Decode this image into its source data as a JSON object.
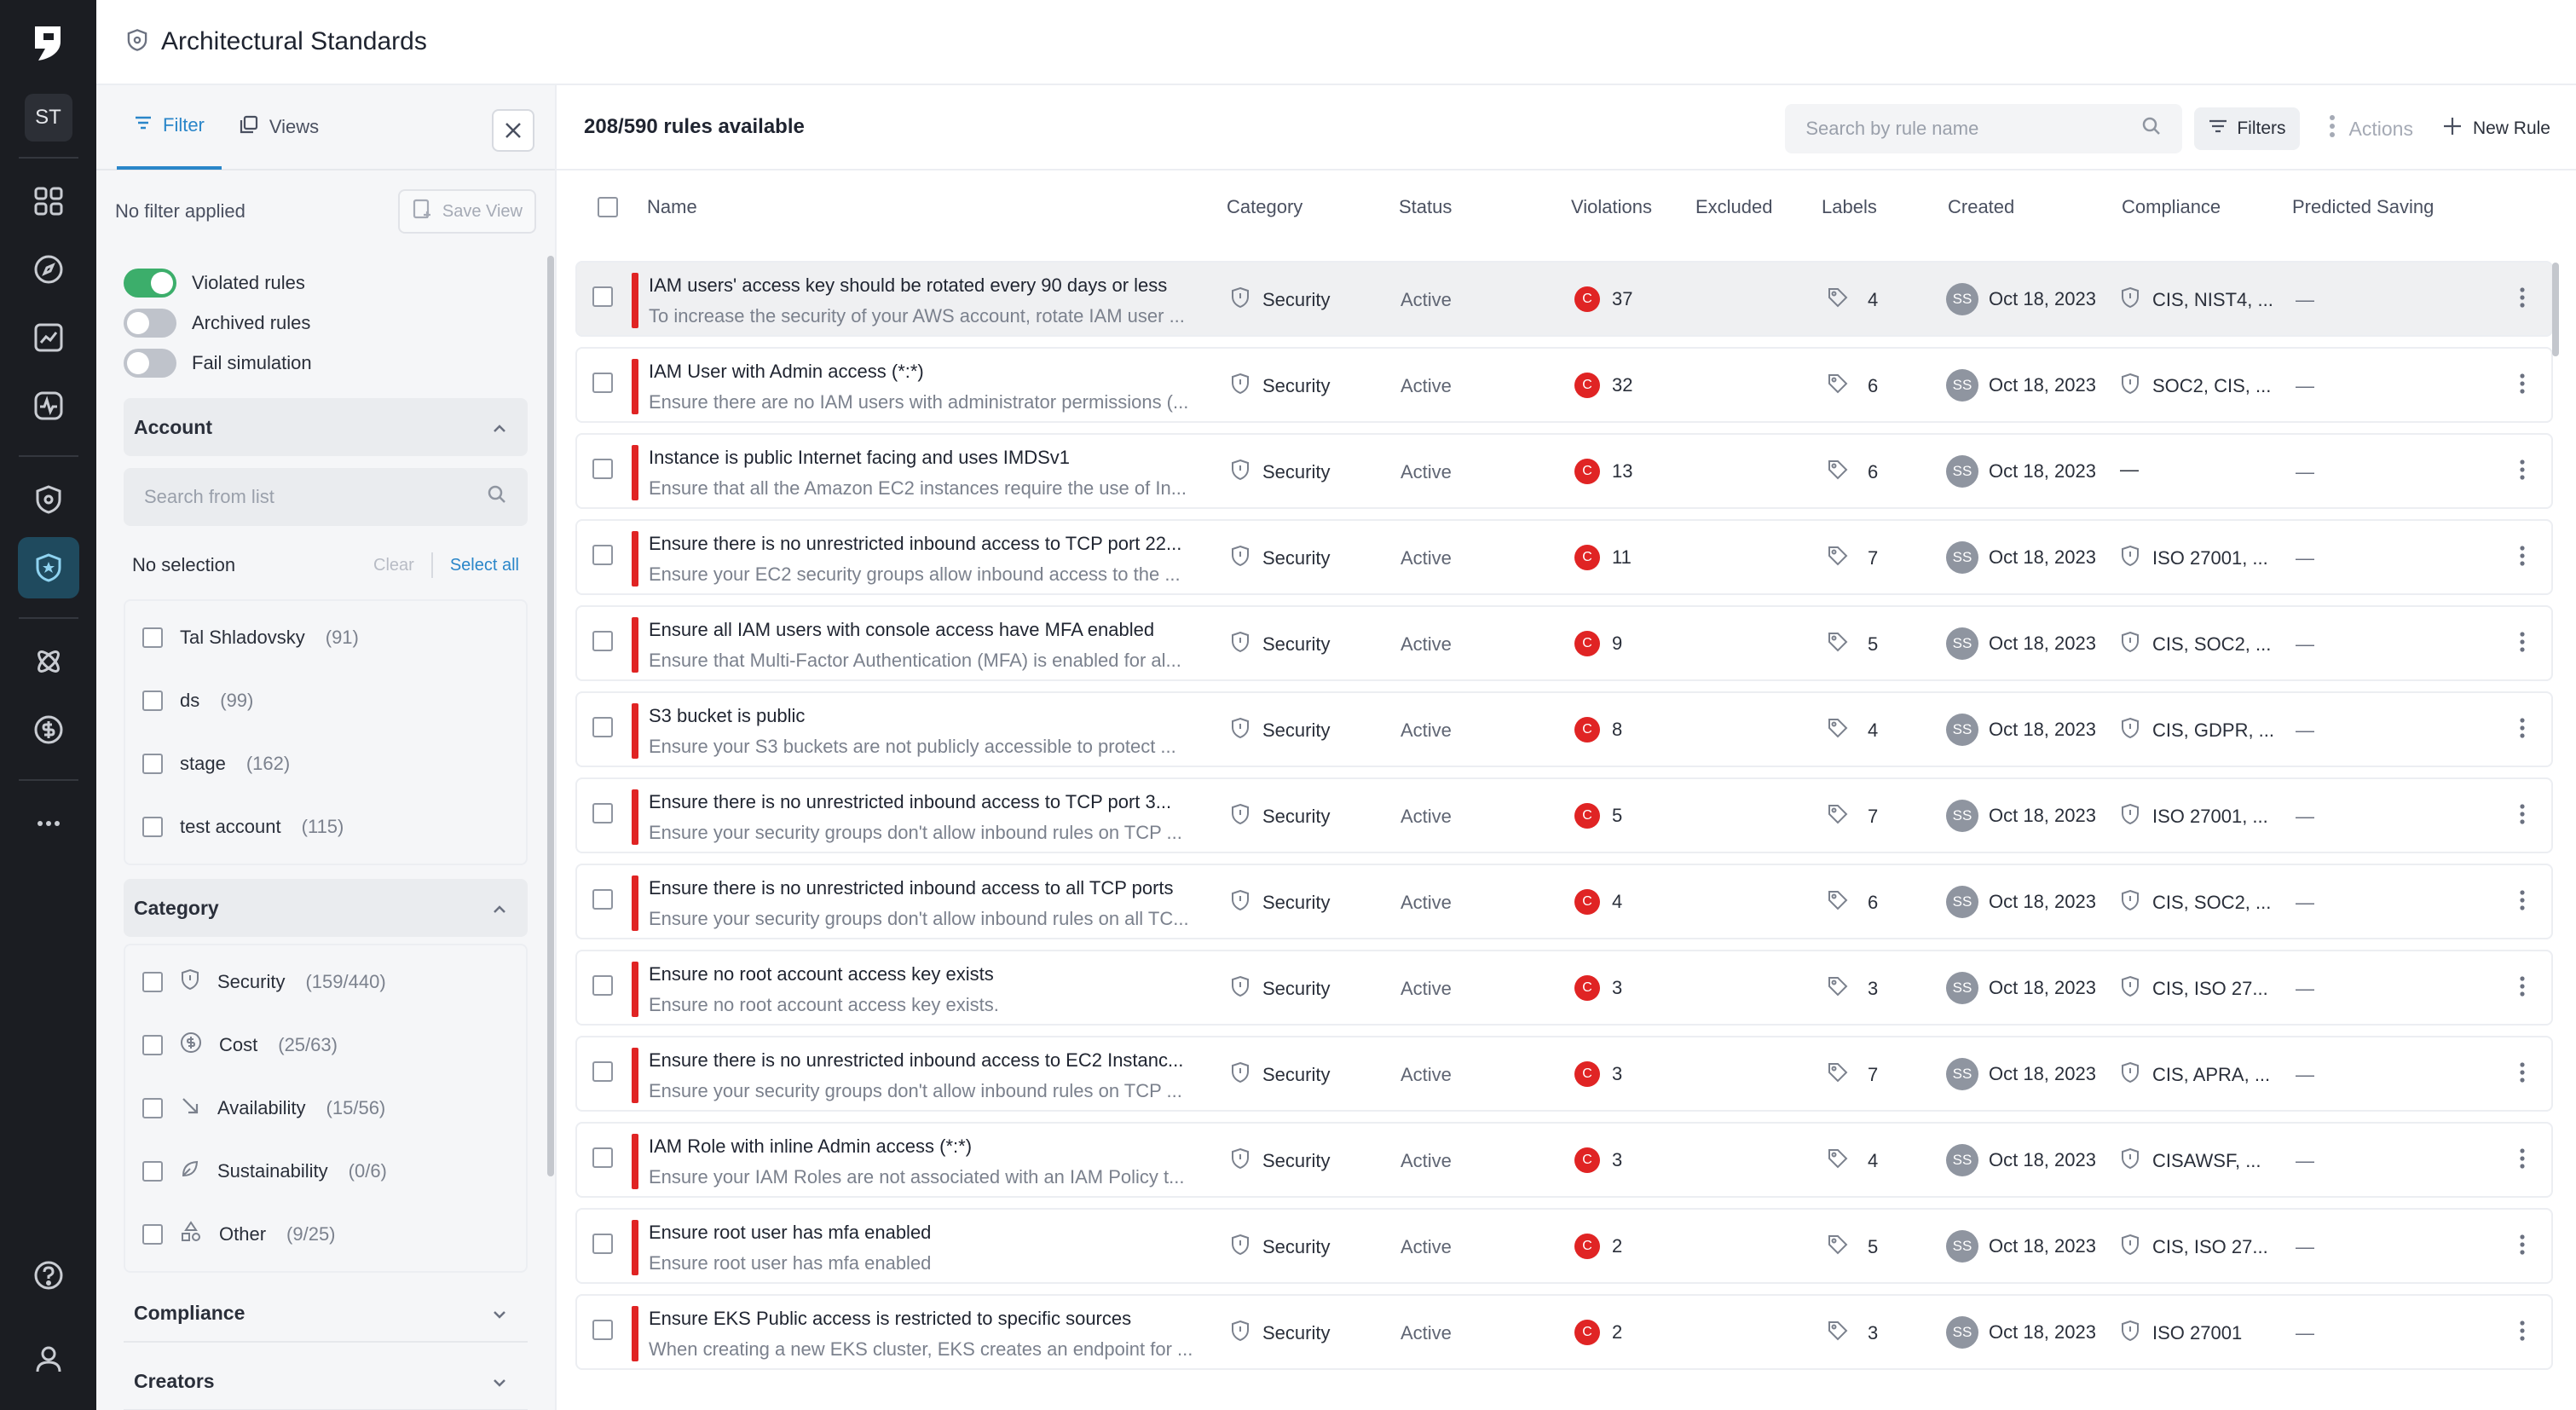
{
  "nav": {
    "avatar_initials": "ST",
    "items": [
      "grid-icon",
      "compass-icon",
      "chart-icon",
      "activity-icon",
      "shield-gear-icon",
      "shield-star-icon",
      "atom-icon",
      "dollar-icon",
      "more-icon"
    ],
    "bottom": [
      "help-icon",
      "user-icon"
    ]
  },
  "header": {
    "title": "Architectural Standards"
  },
  "filter_pane": {
    "tabs": [
      {
        "label": "Filter"
      },
      {
        "label": "Views"
      }
    ],
    "no_filter": "No filter applied",
    "save_view": "Save View",
    "toggles": [
      {
        "label": "Violated rules",
        "on": true
      },
      {
        "label": "Archived rules",
        "on": false
      },
      {
        "label": "Fail simulation",
        "on": false
      }
    ],
    "account": {
      "title": "Account",
      "search_placeholder": "Search from list",
      "no_selection": "No selection",
      "clear": "Clear",
      "select_all": "Select all",
      "options": [
        {
          "label": "Tal Shladovsky",
          "count": "(91)"
        },
        {
          "label": "ds",
          "count": "(99)"
        },
        {
          "label": "stage",
          "count": "(162)"
        },
        {
          "label": "test account",
          "count": "(115)"
        }
      ]
    },
    "category": {
      "title": "Category",
      "options": [
        {
          "label": "Security",
          "count": "(159/440)",
          "icon": "shield-icon"
        },
        {
          "label": "Cost",
          "count": "(25/63)",
          "icon": "dollar-icon"
        },
        {
          "label": "Availability",
          "count": "(15/56)",
          "icon": "arrow-down-right-icon"
        },
        {
          "label": "Sustainability",
          "count": "(0/6)",
          "icon": "leaf-icon"
        },
        {
          "label": "Other",
          "count": "(9/25)",
          "icon": "shapes-icon"
        }
      ]
    },
    "compliance": {
      "title": "Compliance"
    },
    "creators": {
      "title": "Creators"
    }
  },
  "toolbar": {
    "count": "208/590 rules available",
    "search_placeholder": "Search by rule name",
    "filters": "Filters",
    "actions": "Actions",
    "new_rule": "New Rule"
  },
  "columns": {
    "name": "Name",
    "category": "Category",
    "status": "Status",
    "violations": "Violations",
    "excluded": "Excluded",
    "labels": "Labels",
    "created": "Created",
    "compliance": "Compliance",
    "predicted_saving": "Predicted Saving"
  },
  "rows": [
    {
      "title": "IAM users' access key should be rotated every 90 days or less",
      "desc": "To increase the security of your AWS account, rotate IAM user ...",
      "category": "Security",
      "status": "Active",
      "badge": "C",
      "violations": "37",
      "labels": "4",
      "creator": "SS",
      "created": "Oct 18, 2023",
      "compliance": "CIS, NIST4, ...",
      "saving": "—"
    },
    {
      "title": "IAM User with Admin access (*:*)",
      "desc": "Ensure there are no IAM users with administrator permissions (...",
      "category": "Security",
      "status": "Active",
      "badge": "C",
      "violations": "32",
      "labels": "6",
      "creator": "SS",
      "created": "Oct 18, 2023",
      "compliance": "SOC2, CIS, ...",
      "saving": "—"
    },
    {
      "title": "Instance is public Internet facing and uses IMDSv1",
      "desc": "Ensure that all the Amazon EC2 instances require the use of In...",
      "category": "Security",
      "status": "Active",
      "badge": "C",
      "violations": "13",
      "labels": "6",
      "creator": "SS",
      "created": "Oct 18, 2023",
      "compliance": "—",
      "saving": "—"
    },
    {
      "title": "Ensure there is no unrestricted inbound access to TCP port 22...",
      "desc": "Ensure your EC2 security groups allow inbound access to the ...",
      "category": "Security",
      "status": "Active",
      "badge": "C",
      "violations": "11",
      "labels": "7",
      "creator": "SS",
      "created": "Oct 18, 2023",
      "compliance": "ISO 27001, ...",
      "saving": "—"
    },
    {
      "title": "Ensure all IAM users with console access have MFA enabled",
      "desc": "Ensure that Multi-Factor Authentication (MFA) is enabled for al...",
      "category": "Security",
      "status": "Active",
      "badge": "C",
      "violations": "9",
      "labels": "5",
      "creator": "SS",
      "created": "Oct 18, 2023",
      "compliance": "CIS, SOC2, ...",
      "saving": "—"
    },
    {
      "title": "S3 bucket is public",
      "desc": "Ensure your S3 buckets are not publicly accessible to protect ...",
      "category": "Security",
      "status": "Active",
      "badge": "C",
      "violations": "8",
      "labels": "4",
      "creator": "SS",
      "created": "Oct 18, 2023",
      "compliance": "CIS, GDPR, ...",
      "saving": "—"
    },
    {
      "title": "Ensure there is no unrestricted inbound access to TCP port 3...",
      "desc": "Ensure your security groups don't allow inbound rules on TCP ...",
      "category": "Security",
      "status": "Active",
      "badge": "C",
      "violations": "5",
      "labels": "7",
      "creator": "SS",
      "created": "Oct 18, 2023",
      "compliance": "ISO 27001, ...",
      "saving": "—"
    },
    {
      "title": "Ensure there is no unrestricted inbound access to all TCP ports",
      "desc": "Ensure your security groups don't allow inbound rules on all TC...",
      "category": "Security",
      "status": "Active",
      "badge": "C",
      "violations": "4",
      "labels": "6",
      "creator": "SS",
      "created": "Oct 18, 2023",
      "compliance": "CIS, SOC2, ...",
      "saving": "—"
    },
    {
      "title": "Ensure no root account access key exists",
      "desc": "Ensure no root account access key exists.",
      "category": "Security",
      "status": "Active",
      "badge": "C",
      "violations": "3",
      "labels": "3",
      "creator": "SS",
      "created": "Oct 18, 2023",
      "compliance": "CIS, ISO 27...",
      "saving": "—"
    },
    {
      "title": "Ensure there is no unrestricted inbound access to EC2 Instanc...",
      "desc": "Ensure your security groups don't allow inbound rules on TCP ...",
      "category": "Security",
      "status": "Active",
      "badge": "C",
      "violations": "3",
      "labels": "7",
      "creator": "SS",
      "created": "Oct 18, 2023",
      "compliance": "CIS, APRA, ...",
      "saving": "—"
    },
    {
      "title": "IAM Role with inline Admin access (*:*)",
      "desc": "Ensure your IAM Roles are not associated with an IAM Policy t...",
      "category": "Security",
      "status": "Active",
      "badge": "C",
      "violations": "3",
      "labels": "4",
      "creator": "SS",
      "created": "Oct 18, 2023",
      "compliance": "CISAWSF, ...",
      "saving": "—"
    },
    {
      "title": "Ensure root user has mfa enabled",
      "desc": "Ensure root user has mfa enabled",
      "category": "Security",
      "status": "Active",
      "badge": "C",
      "violations": "2",
      "labels": "5",
      "creator": "SS",
      "created": "Oct 18, 2023",
      "compliance": "CIS, ISO 27...",
      "saving": "—"
    },
    {
      "title": "Ensure EKS Public access is restricted to specific sources",
      "desc": "When creating a new EKS cluster, EKS creates an endpoint for ...",
      "category": "Security",
      "status": "Active",
      "badge": "C",
      "violations": "2",
      "labels": "3",
      "creator": "SS",
      "created": "Oct 18, 2023",
      "compliance": "ISO 27001",
      "saving": "—"
    }
  ]
}
